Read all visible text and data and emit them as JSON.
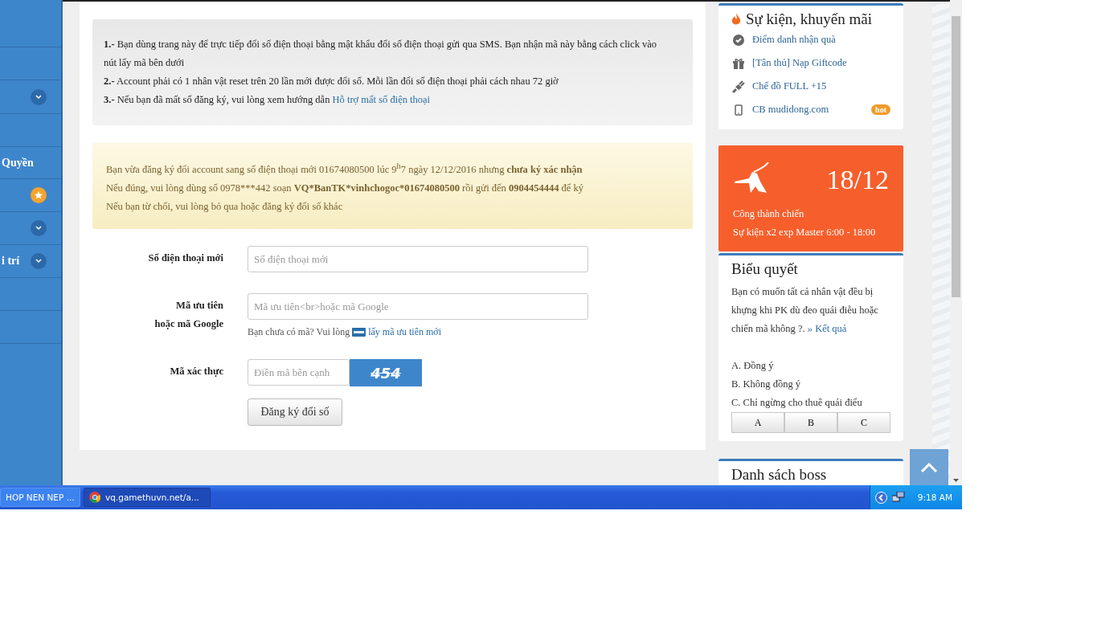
{
  "sidebar": {
    "items": [
      {
        "kind": "plain"
      },
      {
        "kind": "plain"
      },
      {
        "kind": "chevron"
      },
      {
        "kind": "plain"
      },
      {
        "kind": "plain",
        "label": "Quyền"
      },
      {
        "kind": "star"
      },
      {
        "kind": "chevron"
      },
      {
        "kind": "chevron",
        "label": "i trí"
      },
      {
        "kind": "plain"
      },
      {
        "kind": "plain"
      }
    ]
  },
  "info": {
    "items": [
      {
        "text": "**1.-** Bạn dùng trang này để trực tiếp đổi số điện thoại bằng mật khẩu đổi số điện thoại gửi qua SMS. Bạn nhận mã này bằng cách click vào nút lấy mã bên dưới"
      },
      {
        "text": "**2.-** Account phải có 1 nhân vật reset trên 20 lần mới được đổi số. Mỗi lần đổi số điện thoại phải cách nhau 72 giờ"
      },
      {
        "text": "**3.-** Nếu bạn đã mất số đăng ký, vui lòng xem hướng dẫn",
        "link": "Hỗ trợ mất số điện thoại"
      }
    ]
  },
  "notice": {
    "lines": [
      [
        {
          "kind": "normal",
          "text": "Bạn vừa đăng ký đổi account sang số điện thoại mới 01674080500 lúc 9"
        },
        {
          "kind": "sup",
          "text": "h"
        },
        {
          "kind": "normal",
          "text": "7 ngày 12/12/2016 nhưng "
        },
        {
          "kind": "bold",
          "text": "chưa ký xác nhận"
        }
      ],
      [
        {
          "kind": "normal",
          "text": "Nếu đúng, vui lòng dùng số 0978***442 soạn "
        },
        {
          "kind": "bold",
          "text": "VQ*BanTK*vinhchogoc*01674080500"
        },
        {
          "kind": "normal",
          "text": " rồi gửi đến "
        },
        {
          "kind": "bold",
          "text": "0904454444"
        },
        {
          "kind": "normal",
          "text": " để ký"
        }
      ],
      [
        {
          "kind": "normal",
          "text": "Nếu bạn từ chối, vui lòng bỏ qua hoặc đăng ký đổi số khác"
        }
      ]
    ]
  },
  "form": {
    "fields": [
      {
        "kind": "text",
        "label": [
          "Số điện thoại mới"
        ],
        "placeholder": "Số điện thoại mới"
      },
      {
        "kind": "code",
        "label": [
          "Mã ưu tiên",
          "hoặc mã Google"
        ],
        "placeholder": "Mã ưu tiên<br>hoặc mã Google",
        "hint": "Bạn chưa có mã? Vui lòng",
        "hint_link": "lấy mã ưu tiên mới"
      },
      {
        "kind": "captcha",
        "label": [
          "Mã xác thực"
        ],
        "placeholder": "Điền mã bên cạnh",
        "captcha": "454"
      }
    ],
    "submit": "Đăng ký đổi số"
  },
  "events": {
    "title": "Sự kiện, khuyến mãi",
    "items": [
      {
        "kind": "check",
        "label": "Điểm danh nhận quà"
      },
      {
        "kind": "gift",
        "label": "[Tân thủ] Nạp Giftcode"
      },
      {
        "kind": "plug",
        "label": "Chế đồ FULL +15"
      },
      {
        "kind": "phone",
        "label": "CB mudidong.com",
        "badge": "hot"
      }
    ]
  },
  "promo": {
    "date": "18/12",
    "title": "Công thành chiến",
    "subtitle": "Sự kiện x2 exp Master 6:00 - 18:00"
  },
  "poll": {
    "title": "Biểu quyết",
    "question": "Bạn có muốn tất cả nhân vật đều bị khựng khi PK dù đeo quái điễu hoặc chiến mã không ?.",
    "result_link": "» Kết quả",
    "options": [
      "A. Đồng ý",
      "B. Không đồng ý",
      "C. Chỉ ngừng cho thuê quái điểu"
    ],
    "buttons": [
      "A",
      "B",
      "C"
    ]
  },
  "boss": {
    "title": "Danh sách boss"
  },
  "taskbar": {
    "tasks": [
      {
        "label": "HOP NEN NEP ...",
        "kind": "plain",
        "selected": false
      },
      {
        "label": "vq.gamethuvn.net/a...",
        "kind": "browser",
        "selected": true
      }
    ],
    "clock": "9:18 AM"
  }
}
